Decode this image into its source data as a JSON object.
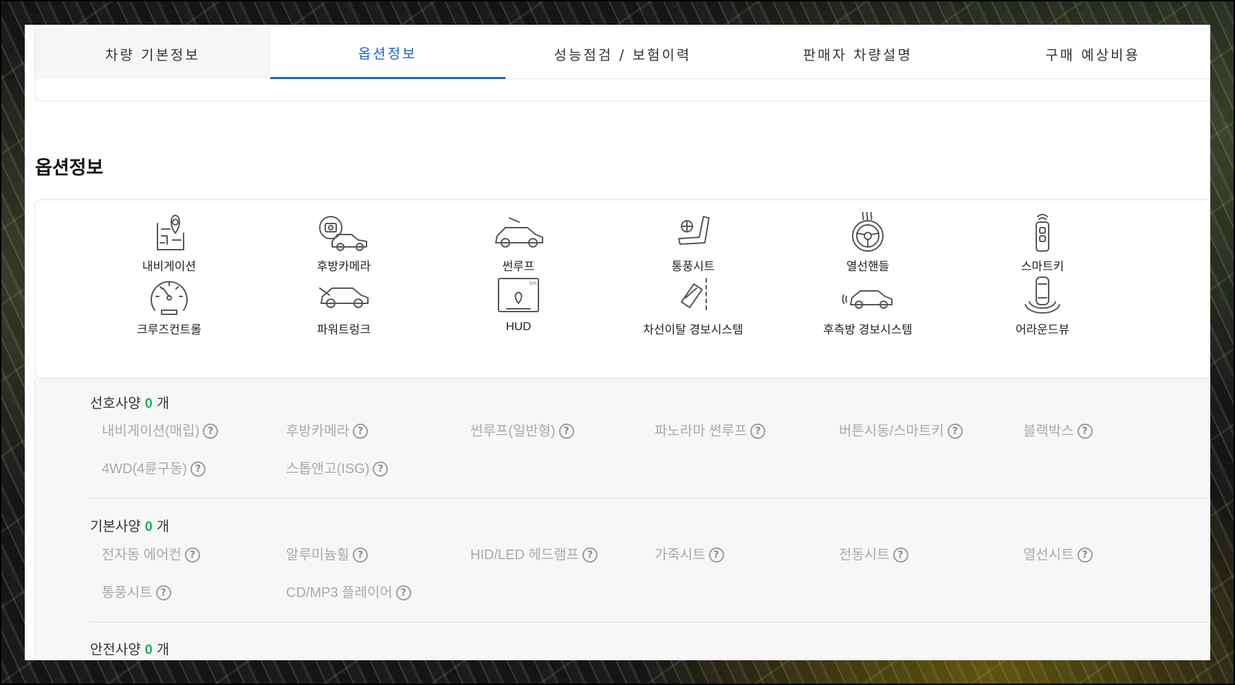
{
  "tabs": [
    {
      "label": "차량 기본정보"
    },
    {
      "label": "옵션정보"
    },
    {
      "label": "성능점검 / 보험이력"
    },
    {
      "label": "판매자 차량설명"
    },
    {
      "label": "구매 예상비용"
    }
  ],
  "section_title": "옵션정보",
  "key_options": [
    {
      "label": "내비게이션",
      "icon": "navigation-map-icon"
    },
    {
      "label": "후방카메라",
      "icon": "rear-camera-icon"
    },
    {
      "label": "썬루프",
      "icon": "sunroof-car-icon"
    },
    {
      "label": "통풍시트",
      "icon": "ventilated-seat-icon"
    },
    {
      "label": "열선핸들",
      "icon": "heated-steering-wheel-icon"
    },
    {
      "label": "스마트키",
      "icon": "smart-key-icon"
    },
    {
      "label": "크루즈컨트롤",
      "icon": "cruise-control-gauge-icon"
    },
    {
      "label": "파워트렁크",
      "icon": "power-trunk-car-icon"
    },
    {
      "label": "HUD",
      "icon": "head-up-display-icon",
      "km_mark": "km"
    },
    {
      "label": "차선이탈 경보시스템",
      "icon": "lane-departure-icon"
    },
    {
      "label": "후측방 경보시스템",
      "icon": "blind-spot-warning-icon"
    },
    {
      "label": "어라운드뷰",
      "icon": "around-view-icon"
    }
  ],
  "groups": [
    {
      "title": "선호사양",
      "count": "0",
      "unit": "개",
      "items": [
        "내비게이션(매립)",
        "후방카메라",
        "썬루프(일반형)",
        "파노라마 썬루프",
        "버튼시동/스마트키",
        "블랙박스",
        "4WD(4륜구동)",
        "스톱앤고(ISG)"
      ]
    },
    {
      "title": "기본사양",
      "count": "0",
      "unit": "개",
      "items": [
        "전자동 에어컨",
        "알루미늄휠",
        "HID/LED 헤드램프",
        "가죽시트",
        "전동시트",
        "열선시트",
        "통풍시트",
        "CD/MP3 플레이어"
      ]
    },
    {
      "title": "안전사양",
      "count": "0",
      "unit": "개",
      "items": []
    }
  ],
  "help_glyph": "?",
  "colors": {
    "accent_blue": "#1d63c4",
    "count_green": "#1fb35a",
    "muted_text": "#a9a9a9"
  }
}
